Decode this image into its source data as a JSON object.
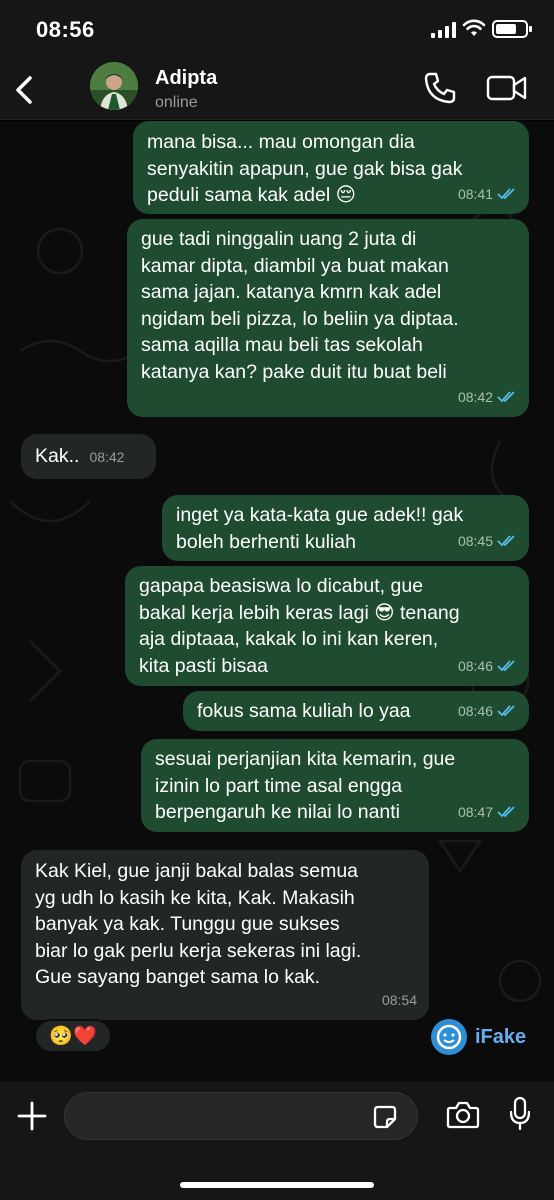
{
  "status_bar": {
    "time": "08:56"
  },
  "header": {
    "name": "Adipta",
    "status": "online"
  },
  "messages": [
    {
      "dir": "out",
      "lines": [
        "mana bisa... mau omongan dia",
        "senyakitin apapun, gue gak bisa gak",
        "peduli sama kak adel 😔"
      ],
      "time": "08:41"
    },
    {
      "dir": "out",
      "lines": [
        "gue tadi ninggalin uang 2 juta di",
        "kamar dipta, diambil ya buat makan",
        "sama jajan. katanya kmrn kak adel",
        "ngidam beli pizza, lo beliin ya diptaa.",
        "sama aqilla mau beli tas sekolah",
        "katanya kan? pake duit itu buat beli"
      ],
      "time": "08:42"
    },
    {
      "dir": "in",
      "lines": [
        "Kak.."
      ],
      "time": "08:42"
    },
    {
      "dir": "out",
      "lines": [
        "inget ya kata-kata gue adek!! gak",
        "boleh berhenti kuliah"
      ],
      "time": "08:45"
    },
    {
      "dir": "out",
      "lines": [
        "gapapa beasiswa lo dicabut, gue",
        "bakal kerja lebih keras lagi 😎 tenang",
        "aja diptaaa, kakak lo ini kan keren,",
        "kita pasti bisaa"
      ],
      "time": "08:46"
    },
    {
      "dir": "out",
      "lines": [
        "fokus sama kuliah lo yaa"
      ],
      "time": "08:46"
    },
    {
      "dir": "out",
      "lines": [
        "sesuai perjanjian kita kemarin, gue",
        "izinin lo part time asal engga",
        "berpengaruh ke nilai lo nanti"
      ],
      "time": "08:47"
    },
    {
      "dir": "in",
      "lines": [
        "Kak Kiel, gue janji bakal balas semua",
        "yg udh lo kasih ke kita, Kak. Makasih",
        "banyak ya kak. Tunggu gue sukses",
        "biar lo gak perlu kerja sekeras ini lagi.",
        "Gue sayang banget sama lo kak."
      ],
      "time": "08:54"
    }
  ],
  "reaction": "🥺❤️",
  "watermark": "iFake",
  "input": {
    "value": "",
    "placeholder": ""
  },
  "colors": {
    "outgoing_bubble": "#1f4b30",
    "incoming_bubble": "#232626",
    "ticks": "#53bdeb"
  }
}
